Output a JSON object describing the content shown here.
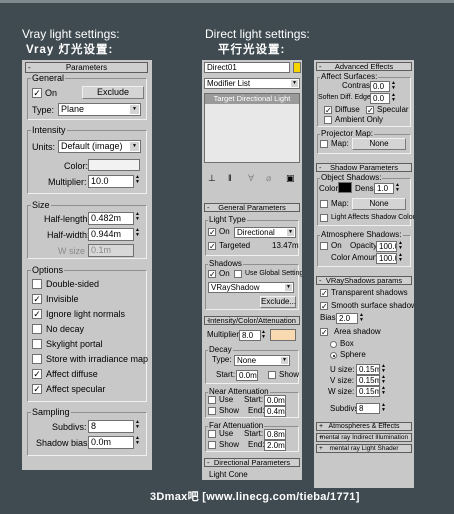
{
  "headings": {
    "vray_title": "Vray light settings:",
    "vray_title_cn": "Vray 灯光设置:",
    "direct_title": "Direct light settings:",
    "direct_title_cn": "平行光设置:"
  },
  "vray": {
    "rollout": "Parameters",
    "general": {
      "title": "General",
      "on_label": "On",
      "on_checked": true,
      "exclude_button": "Exclude",
      "type_label": "Type:",
      "type_value": "Plane"
    },
    "intensity": {
      "title": "Intensity",
      "units_label": "Units:",
      "units_value": "Default (image)",
      "color_label": "Color:",
      "color_value": "#f2f2f2",
      "multiplier_label": "Multiplier:",
      "multiplier_value": "10.0"
    },
    "size": {
      "title": "Size",
      "half_length_label": "Half-length:",
      "half_length_value": "0.482m",
      "half_width_label": "Half-width:",
      "half_width_value": "0.944m",
      "wsize_label": "W size",
      "wsize_value": "0.1m"
    },
    "options": {
      "title": "Options",
      "items": [
        {
          "label": "Double-sided",
          "checked": false
        },
        {
          "label": "Invisible",
          "checked": true
        },
        {
          "label": "Ignore light normals",
          "checked": true
        },
        {
          "label": "No decay",
          "checked": false
        },
        {
          "label": "Skylight portal",
          "checked": false
        },
        {
          "label": "Store with irradiance map",
          "checked": false
        },
        {
          "label": "Affect diffuse",
          "checked": true
        },
        {
          "label": "Affect specular",
          "checked": true
        }
      ]
    },
    "sampling": {
      "title": "Sampling",
      "subdivs_label": "Subdivs:",
      "subdivs_value": "8",
      "shadow_bias_label": "Shadow bias:",
      "shadow_bias_value": "0.0m"
    }
  },
  "direct_top": {
    "name_value": "Direct01",
    "name_color": "#f5d400",
    "modifier_list": "Modifier List",
    "stack_item": "Target Directional Light",
    "toolbar_icons": [
      "pin-icon",
      "show-end-icon",
      "unique-icon",
      "remove-modifier-icon",
      "configure-icon"
    ]
  },
  "general_params": {
    "rollout": "General Parameters",
    "light_type_title": "Light Type",
    "on_label": "On",
    "on_checked": true,
    "type_value": "Directional",
    "targeted_label": "Targeted",
    "targeted_checked": true,
    "targeted_distance": "13.47m",
    "shadows_title": "Shadows",
    "shadows_on_label": "On",
    "shadows_on_checked": true,
    "global_label": "Use Global Settings",
    "global_checked": false,
    "shadow_type": "VRayShadow",
    "exclude_button": "Exclude..."
  },
  "intensity_color": {
    "rollout": "Intensity/Color/Attenuation",
    "multiplier_label": "Multiplier:",
    "multiplier_value": "8.0",
    "swatch_color": "#f8d9b0",
    "decay_title": "Decay",
    "type_label": "Type:",
    "type_value": "None",
    "start_label": "Start:",
    "start_value": "0.0m",
    "show_label": "Show",
    "near_title": "Near Attenuation",
    "near_use": "Use",
    "near_start_label": "Start:",
    "near_start_value": "0.0m",
    "near_show": "Show",
    "near_end_label": "End:",
    "near_end_value": "0.4m",
    "far_title": "Far Attenuation",
    "far_use": "Use",
    "far_start_label": "Start:",
    "far_start_value": "0.8m",
    "far_show": "Show",
    "far_end_label": "End:",
    "far_end_value": "2.0m"
  },
  "directional_params": {
    "rollout": "Directional Parameters",
    "cone_title": "Light Cone",
    "show_cone": "Show Cone",
    "overshoot": "Overshoot",
    "hotspot_label": "Hotspot/Beam:",
    "falloff_label": "Falloff/Field:",
    "falloff_value": "4.55m"
  },
  "advanced_effects": {
    "rollout": "Advanced Effects",
    "affect_surfaces_title": "Affect Surfaces:",
    "contrast_label": "Contrast:",
    "contrast_value": "0.0",
    "soften_label": "Soften Diff. Edge:",
    "soften_value": "0.0",
    "diffuse_label": "Diffuse",
    "diffuse_checked": true,
    "specular_label": "Specular",
    "specular_checked": true,
    "ambient_label": "Ambient Only",
    "ambient_checked": false,
    "projector_title": "Projector Map:",
    "map_label": "Map:",
    "map_button": "None"
  },
  "shadow_params": {
    "rollout": "Shadow Parameters",
    "object_shadows_title": "Object Shadows:",
    "color_label": "Color:",
    "color_value": "#000000",
    "dens_label": "Dens.",
    "dens_value": "1.0",
    "map_label": "Map:",
    "map_button": "None",
    "light_affects_label": "Light Affects Shadow Color",
    "atmosphere_title": "Atmosphere Shadows:",
    "atm_on": "On",
    "opacity_label": "Opacity:",
    "opacity_value": "100.0",
    "color_amount_label": "Color Amount:",
    "color_amount_value": "100.0"
  },
  "vray_shadows": {
    "rollout": "VRayShadows params",
    "transparent_label": "Transparent shadows",
    "transparent_checked": true,
    "smooth_label": "Smooth surface shadows",
    "smooth_checked": true,
    "bias_label": "Bias:",
    "bias_value": "2.0",
    "area_label": "Area shadow",
    "area_checked": true,
    "box_label": "Box",
    "sphere_label": "Sphere",
    "u_label": "U size:",
    "u_value": "0.15m",
    "v_label": "V size:",
    "v_value": "0.15m",
    "w_label": "W size:",
    "w_value": "0.15m",
    "subdivs_label": "Subdivs:",
    "subdivs_value": "8"
  },
  "bottom_rollouts": [
    "Atmospheres & Effects",
    "mental ray Indirect Illumination",
    "mental ray Light Shader"
  ],
  "watermark": "3Dmax吧 [www.linecg.com/tieba/1771]"
}
